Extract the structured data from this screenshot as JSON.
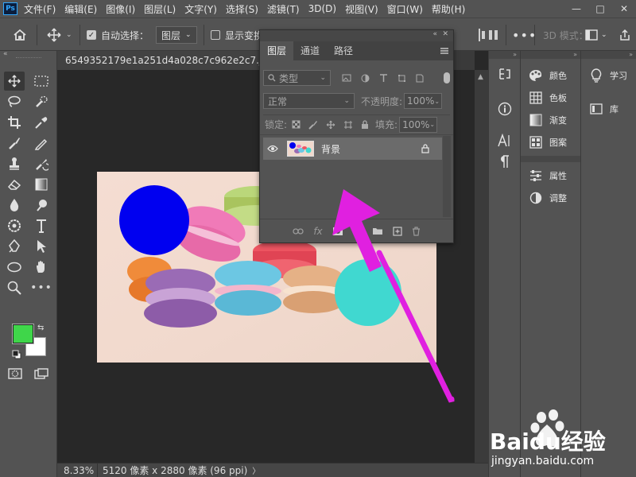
{
  "app": {
    "logo": "Ps"
  },
  "menu": [
    "文件(F)",
    "编辑(E)",
    "图像(I)",
    "图层(L)",
    "文字(Y)",
    "选择(S)",
    "滤镜(T)",
    "3D(D)",
    "视图(V)",
    "窗口(W)",
    "帮助(H)"
  ],
  "window_controls": {
    "minimize": "—",
    "maximize": "□",
    "close": "✕"
  },
  "options_bar": {
    "auto_select_label": "自动选择：",
    "auto_select_checked": true,
    "target_value": "图层",
    "show_transform_label": "显示变换",
    "mode_3d_label": "3D 模式："
  },
  "document": {
    "tab_title": "6549352179e1a251d4a028c7c962e2c7.jpeg @",
    "zoom": "8.33%",
    "size_info": "5120 像素 x 2880 像素 (96 ppi)"
  },
  "toolbox": {
    "foreground_color": "#3fd64a",
    "background_color": "#ffffff"
  },
  "layers_panel": {
    "tabs": [
      "图层",
      "通道",
      "路径"
    ],
    "active_tab": 0,
    "filter_label": "类型",
    "blend_mode": "正常",
    "opacity_label": "不透明度:",
    "opacity_value": "100%",
    "lock_label": "锁定:",
    "fill_label": "填充:",
    "fill_value": "100%",
    "layers": [
      {
        "name": "背景",
        "locked": true,
        "visible": true
      }
    ]
  },
  "right_panels": {
    "group1": [
      "颜色",
      "色板",
      "渐变",
      "图案"
    ],
    "group2": [
      "属性",
      "调整"
    ],
    "group3": [
      "学习",
      "库"
    ]
  },
  "image": {
    "circle_blue": "#0000f0",
    "circle_cyan": "#40d8d0"
  },
  "annotation": {
    "arrow_color": "#e020e0"
  },
  "watermark": {
    "brand": "Baidu经验",
    "url": "jingyan.baidu.com"
  }
}
